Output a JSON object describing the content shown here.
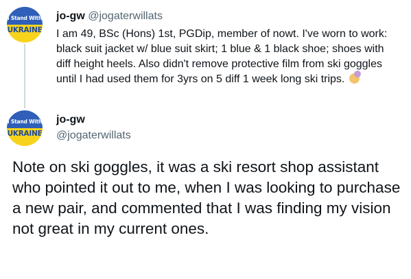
{
  "tweet1": {
    "display_name": "jo-gw",
    "handle": "@jogaterwillats",
    "avatar": {
      "line1": "I Stand With",
      "line2": "UKRAINE"
    },
    "text": "I am 49, BSc (Hons) 1st, PGDip, member of nowt. I've worn to work: black suit jacket w/ blue suit skirt; 1 blue & 1 black shoe; shoes with diff height heels. Also didn't remove protective film from ski goggles until I had used them for 3yrs on 5 diff 1 week long ski trips.",
    "emoji": "woman-facepalming-emoji"
  },
  "tweet2": {
    "display_name": "jo-gw",
    "handle": "@jogaterwillats",
    "avatar": {
      "line1": "I Stand With",
      "line2": "UKRAINE"
    },
    "text": "Note on ski goggles, it was a ski resort shop assistant who pointed it out to me, when I was looking to purchase a new pair, and commented that I was finding my vision not great in my current ones."
  },
  "colors": {
    "text": "#0f1419",
    "secondary_text": "#536471",
    "thread_line": "#cfd9de",
    "avatar_blue": "#2f5fb8",
    "avatar_yellow": "#f8d31c"
  }
}
